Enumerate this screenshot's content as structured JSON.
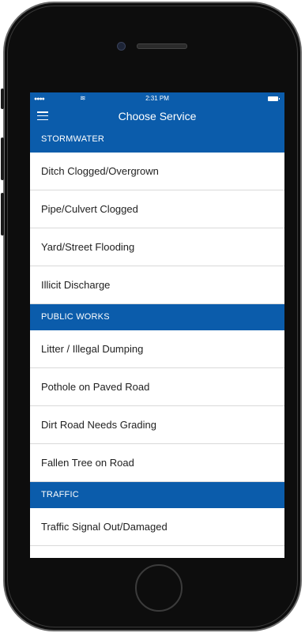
{
  "status_bar": {
    "signal": "●●●●",
    "wifi": "≋",
    "time": "2:31 PM"
  },
  "nav": {
    "title": "Choose Service",
    "menu_icon": "hamburger-menu-icon"
  },
  "colors": {
    "accent": "#0b5cab",
    "background": "#ffffff",
    "divider": "#d9d9d9"
  },
  "sections": [
    {
      "header": "STORMWATER",
      "items": [
        "Ditch Clogged/Overgrown",
        "Pipe/Culvert Clogged",
        "Yard/Street Flooding",
        "Illicit Discharge"
      ]
    },
    {
      "header": "PUBLIC WORKS",
      "items": [
        "Litter / Illegal Dumping",
        "Pothole on Paved Road",
        "Dirt Road Needs Grading",
        "Fallen Tree on Road"
      ]
    },
    {
      "header": "TRAFFIC",
      "items": [
        "Traffic Signal Out/Damaged"
      ]
    }
  ]
}
